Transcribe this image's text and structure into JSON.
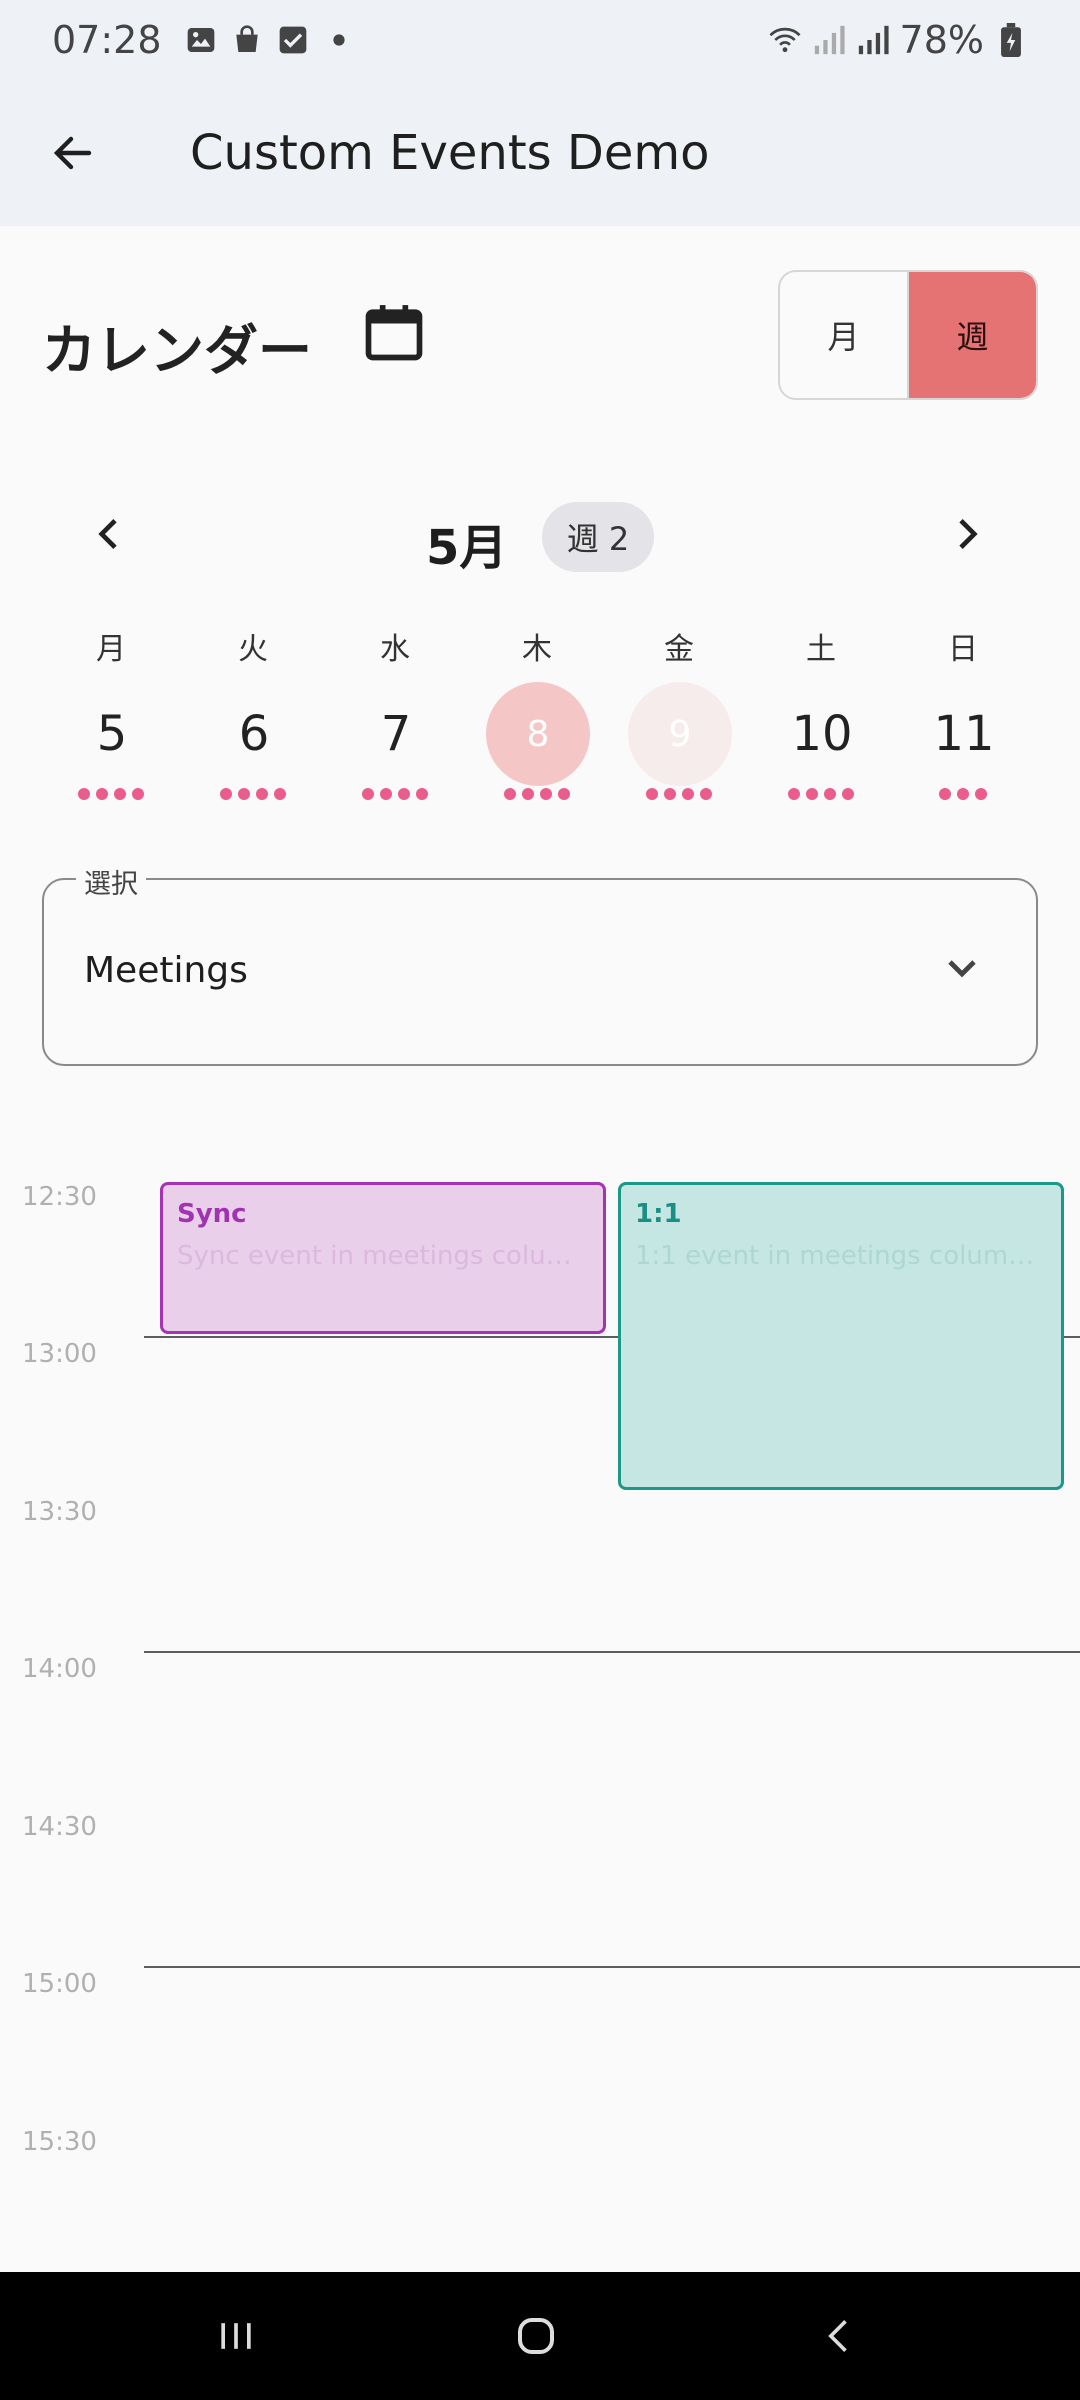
{
  "status_bar": {
    "time": "07:28",
    "battery": "78%",
    "left_icons": [
      "image-icon",
      "shopping-bag-icon",
      "checkbox-icon",
      "dot-icon"
    ],
    "right_icons": [
      "wifi-icon",
      "signal-icon",
      "signal-icon",
      "battery-icon"
    ]
  },
  "app_bar": {
    "title": "Custom Events Demo",
    "back_icon": "arrow-left-icon"
  },
  "calendar": {
    "title": "カレンダー",
    "view_toggle": {
      "month_label": "月",
      "week_label": "週",
      "selected": "週"
    },
    "month_label": "5月",
    "week_chip": "週 2",
    "days": [
      {
        "label": "月",
        "date": "5",
        "dots": 4,
        "state": "normal"
      },
      {
        "label": "火",
        "date": "6",
        "dots": 4,
        "state": "normal"
      },
      {
        "label": "水",
        "date": "7",
        "dots": 4,
        "state": "normal"
      },
      {
        "label": "木",
        "date": "8",
        "dots": 4,
        "state": "today"
      },
      {
        "label": "金",
        "date": "9",
        "dots": 4,
        "state": "selected"
      },
      {
        "label": "土",
        "date": "10",
        "dots": 4,
        "state": "normal"
      },
      {
        "label": "日",
        "date": "11",
        "dots": 3,
        "state": "normal"
      }
    ]
  },
  "select": {
    "legend": "選択",
    "value": "Meetings"
  },
  "timeline": {
    "times": [
      "12:30",
      "13:00",
      "13:30",
      "14:00",
      "14:30",
      "15:00",
      "15:30"
    ],
    "events": [
      {
        "title": "Sync",
        "description": "Sync event in meetings colu…"
      },
      {
        "title": "1:1",
        "description": "1:1 event in meetings column…"
      }
    ]
  },
  "colors": {
    "accent": "#e57373",
    "dot": "#e95c8c",
    "sync_border": "#a433b6",
    "one_on_one_border": "#1c9788"
  }
}
